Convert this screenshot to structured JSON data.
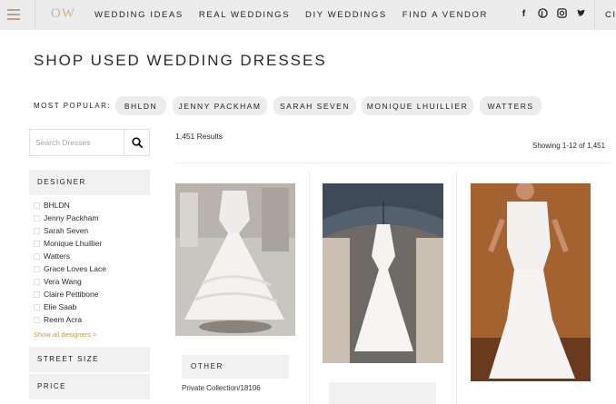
{
  "header": {
    "logo": "OW",
    "nav": [
      "WEDDING IDEAS",
      "REAL WEDDINGS",
      "DIY WEDDINGS",
      "FIND A VENDOR"
    ],
    "social_icons": [
      "facebook-icon",
      "pinterest-icon",
      "instagram-icon",
      "twitter-icon"
    ],
    "cut_label": "CI"
  },
  "page": {
    "title": "SHOP USED WEDDING DRESSES"
  },
  "popular": {
    "label": "MOST POPULAR:",
    "pills": [
      "BHLDN",
      "JENNY PACKHAM",
      "SARAH SEVEN",
      "MONIQUE LHUILLIER",
      "WATTERS"
    ]
  },
  "search": {
    "placeholder": "Search Dresses"
  },
  "filters": {
    "designer_title": "DESIGNER",
    "designers": [
      "BHLDN",
      "Jenny Packham",
      "Sarah Seven",
      "Monique Lhuillier",
      "Watters",
      "Grace Loves Lace",
      "Vera Wang",
      "Claire Pettibone",
      "Elie Saab",
      "Reem Acra"
    ],
    "show_all": "Show all designers >",
    "street_size_title": "STREET SIZE",
    "price_title": "PRICE"
  },
  "results": {
    "count_text": "1,451 Results",
    "showing_text": "Showing 1-12 of 1,451"
  },
  "cards": [
    {
      "tag": "OTHER",
      "name": "Private Collection/18106"
    },
    {
      "tag": "",
      "name": ""
    },
    {
      "tag": "",
      "name": ""
    }
  ],
  "colors": {
    "accent": "#c29a4d",
    "nav_bg": "#ececec",
    "chip_bg": "#ececec",
    "panel_bg": "#f1f1f1"
  }
}
